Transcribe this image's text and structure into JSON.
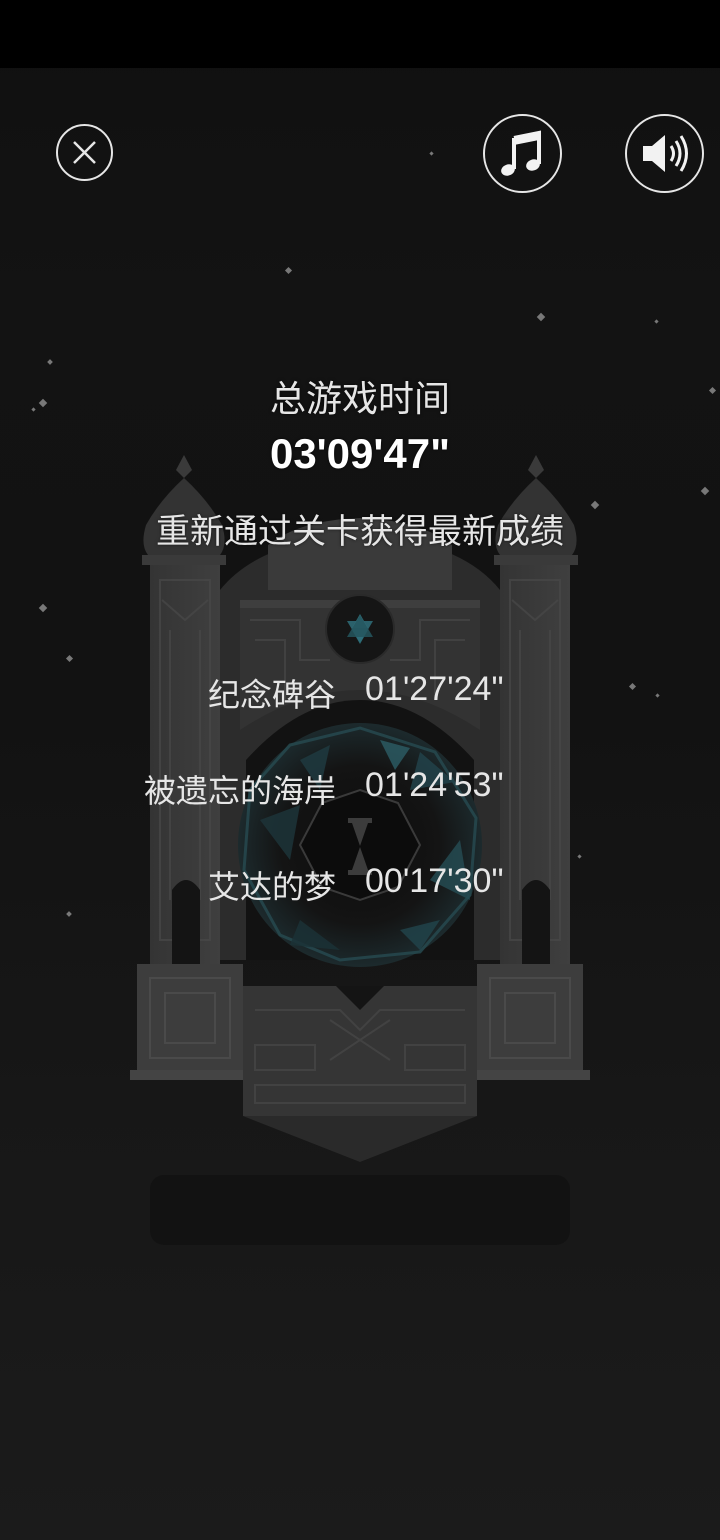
{
  "header": {
    "close_icon": "close-icon",
    "music_icon": "music-note-icon",
    "sound_icon": "speaker-icon"
  },
  "summary": {
    "total_label": "总游戏时间",
    "total_time": "03'09'47\"",
    "replay_hint": "重新通过关卡获得最新成绩"
  },
  "levels": [
    {
      "name": "纪念碑谷",
      "time": "01'27'24\""
    },
    {
      "name": "被遗忘的海岸",
      "time": "01'24'53\""
    },
    {
      "name": "艾达的梦",
      "time": "00'17'30\""
    }
  ],
  "colors": {
    "background": "#121212",
    "text": "#e6e6e6",
    "monument": "#3a3a3a",
    "gem_accent": "#2f6f7a"
  }
}
